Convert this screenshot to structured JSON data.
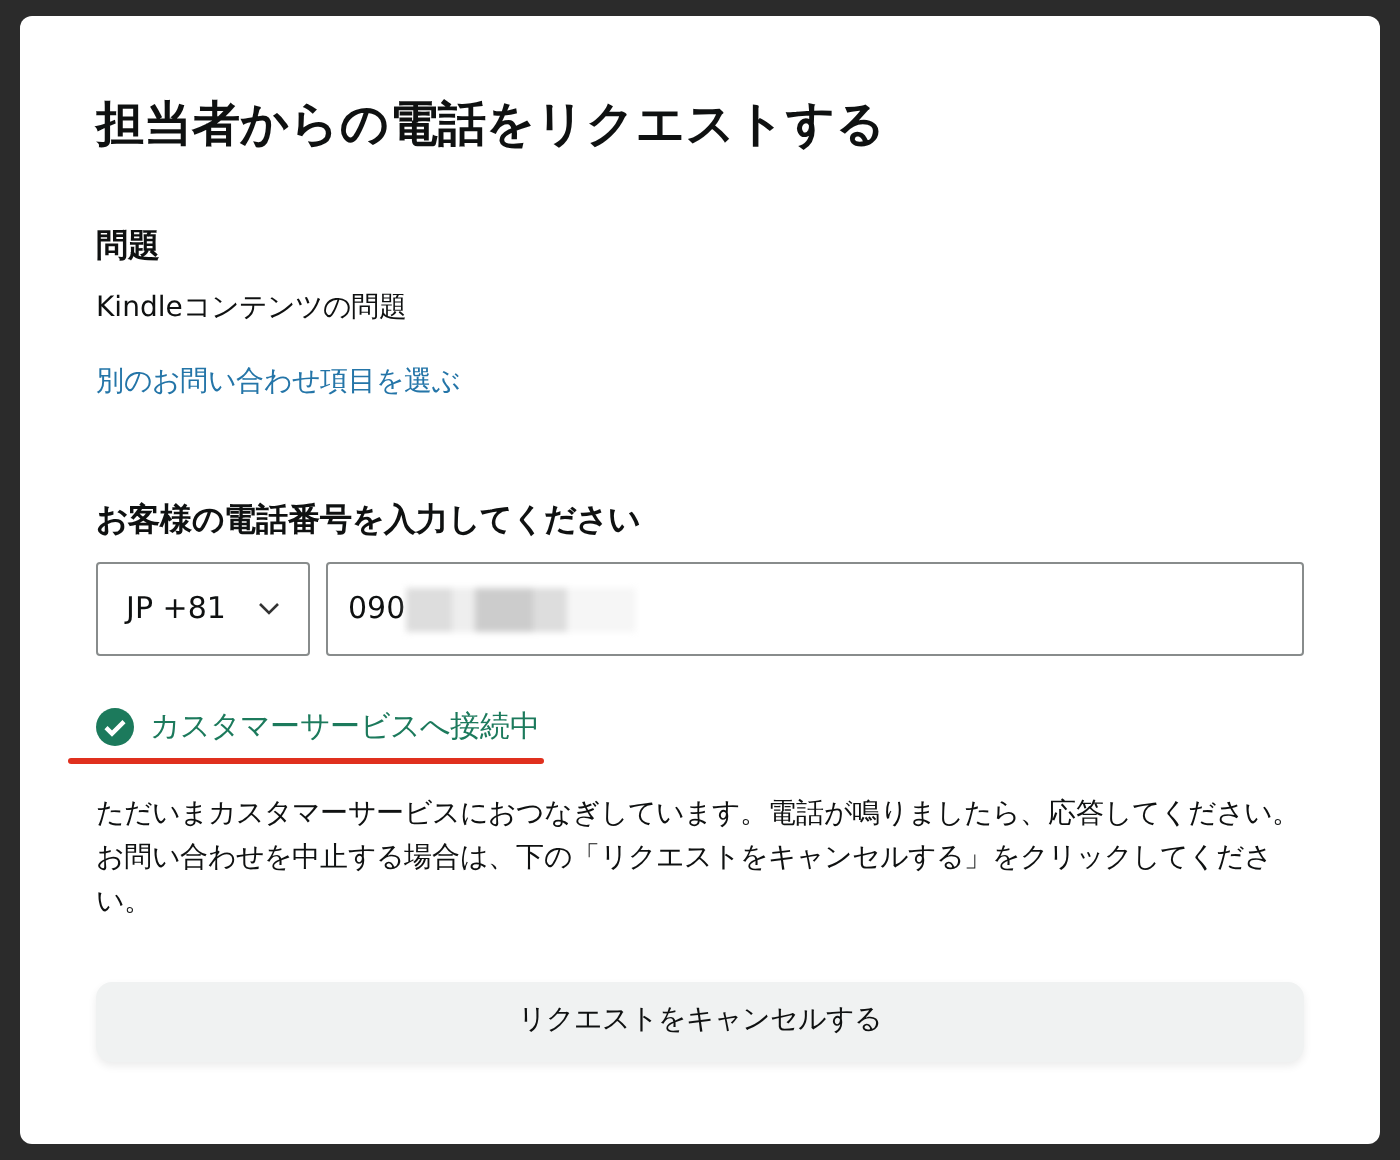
{
  "dialog": {
    "title": "担当者からの電話をリクエストする"
  },
  "issue": {
    "heading": "問題",
    "value": "Kindleコンテンツの問題",
    "link": "別のお問い合わせ項目を選ぶ"
  },
  "phone": {
    "heading": "お客様の電話番号を入力してください",
    "country_code": "JP +81",
    "number": "090",
    "redacted": true
  },
  "status": {
    "text": "カスタマーサービスへ接続中",
    "connected": true,
    "underlined": true
  },
  "message": "ただいまカスタマーサービスにおつなぎしています。電話が鳴りましたら、応答してください。お問い合わせを中止する場合は、下の「リクエストをキャンセルする」をクリックしてください。",
  "cancel_button": "リクエストをキャンセルする"
}
